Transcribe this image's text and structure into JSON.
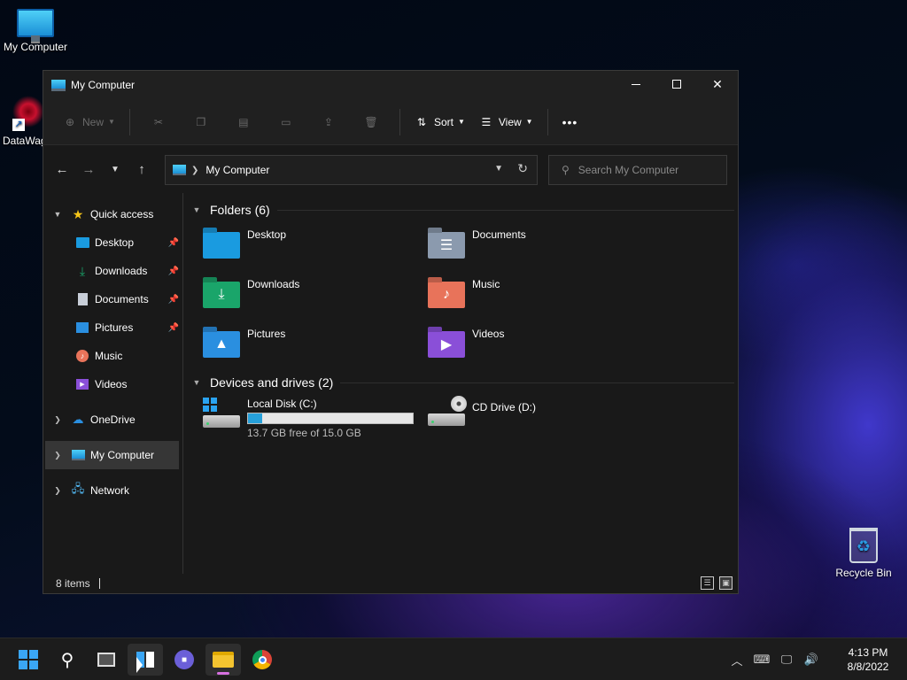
{
  "desktop": {
    "icons": [
      {
        "label": "My Computer"
      },
      {
        "label": "DataWag"
      },
      {
        "label": "Recycle Bin"
      }
    ]
  },
  "window": {
    "title": "My Computer",
    "toolbar": {
      "new_label": "New",
      "sort_label": "Sort",
      "view_label": "View",
      "more_label": "•••"
    },
    "address": {
      "crumb": "My Computer",
      "search_placeholder": "Search My Computer"
    },
    "sidebar": {
      "quick_access": "Quick access",
      "items": [
        {
          "label": "Desktop",
          "pinned": true
        },
        {
          "label": "Downloads",
          "pinned": true
        },
        {
          "label": "Documents",
          "pinned": true
        },
        {
          "label": "Pictures",
          "pinned": true
        },
        {
          "label": "Music",
          "pinned": false
        },
        {
          "label": "Videos",
          "pinned": false
        }
      ],
      "onedrive": "OneDrive",
      "my_computer": "My Computer",
      "network": "Network"
    },
    "content": {
      "folders_header": "Folders (6)",
      "folders": [
        {
          "label": "Desktop",
          "color": "#1a9be0"
        },
        {
          "label": "Documents",
          "color": "#8b9aae"
        },
        {
          "label": "Downloads",
          "color": "#1aa56a"
        },
        {
          "label": "Music",
          "color": "#e8735a"
        },
        {
          "label": "Pictures",
          "color": "#2a8fe0"
        },
        {
          "label": "Videos",
          "color": "#8a4fd8"
        }
      ],
      "drives_header": "Devices and drives (2)",
      "drives": [
        {
          "name": "Local Disk (C:)",
          "free_text": "13.7 GB free of 15.0 GB",
          "used_fraction": 0.087
        },
        {
          "name": "CD Drive (D:)"
        }
      ]
    },
    "status": {
      "items_text": "8 items"
    }
  },
  "taskbar": {
    "clock_time": "4:13 PM",
    "clock_date": "8/8/2022"
  },
  "colors": {
    "accent": "#26a0da",
    "window_bg": "#191919"
  }
}
